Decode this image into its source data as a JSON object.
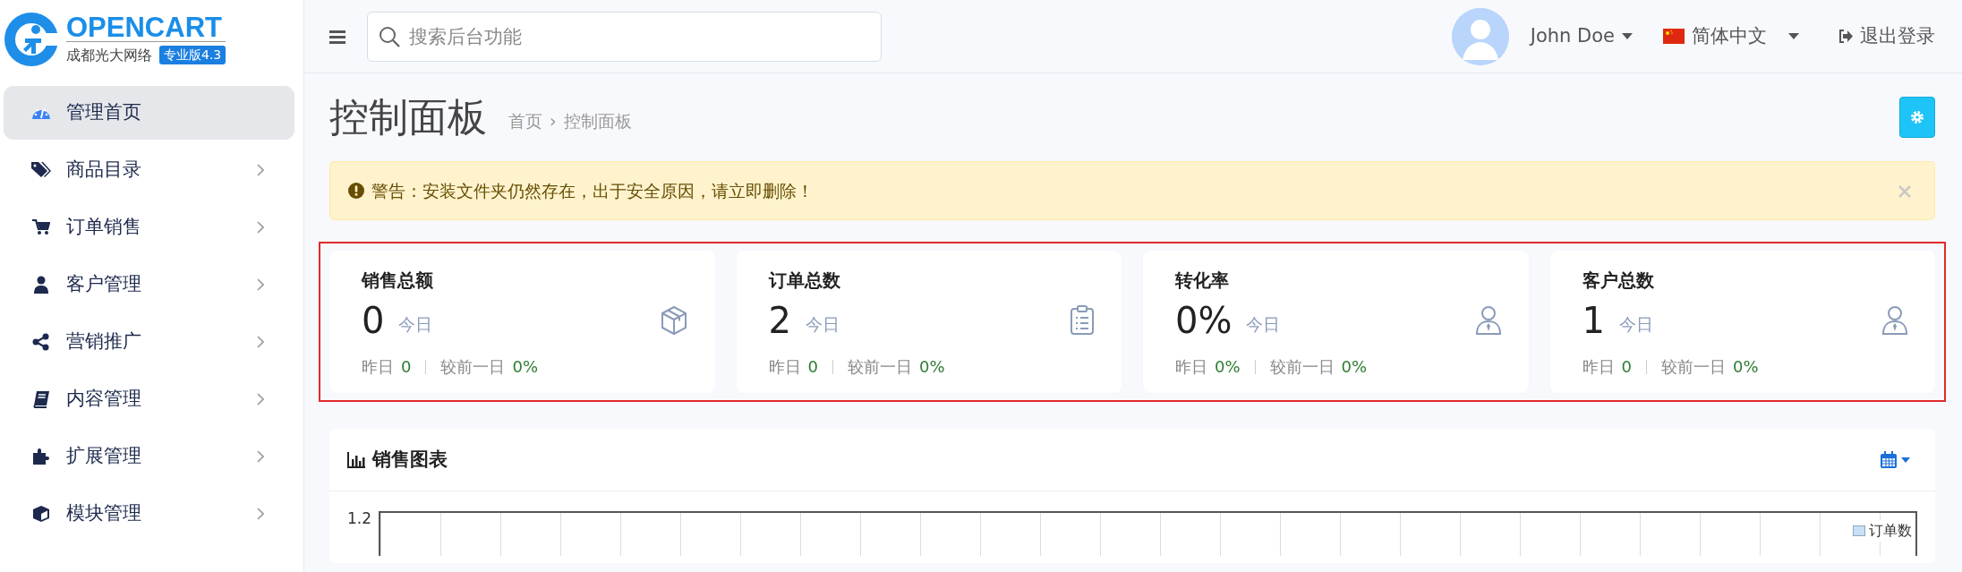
{
  "brand": {
    "name": "OPENCART",
    "subtitle": "成都光大网络",
    "edition": "专业版4.3"
  },
  "search": {
    "placeholder": "搜索后台功能"
  },
  "user": {
    "name": "John Doe"
  },
  "language": {
    "label": "简体中文"
  },
  "logout": {
    "label": "退出登录"
  },
  "sidebar": {
    "items": [
      {
        "label": "管理首页",
        "kind": "dashboard",
        "selected": true,
        "expandable": false
      },
      {
        "label": "商品目录",
        "kind": "tag",
        "selected": false,
        "expandable": true
      },
      {
        "label": "订单销售",
        "kind": "cart",
        "selected": false,
        "expandable": true
      },
      {
        "label": "客户管理",
        "kind": "user",
        "selected": false,
        "expandable": true
      },
      {
        "label": "营销推广",
        "kind": "share",
        "selected": false,
        "expandable": true
      },
      {
        "label": "内容管理",
        "kind": "book",
        "selected": false,
        "expandable": true
      },
      {
        "label": "扩展管理",
        "kind": "puzzle",
        "selected": false,
        "expandable": true
      },
      {
        "label": "模块管理",
        "kind": "cube",
        "selected": false,
        "expandable": true
      }
    ]
  },
  "page": {
    "title": "控制面板",
    "breadcrumbs": [
      "首页",
      "控制面板"
    ],
    "breadcrumb_separator": "›"
  },
  "alert": {
    "text": "警告：安装文件夹仍然存在，出于安全原因，请立即删除！"
  },
  "stats_highlighted": true,
  "stats": [
    {
      "title": "销售总额",
      "value": "0",
      "period": "今日",
      "yesterday_label": "昨日",
      "yesterday": "0",
      "compare_label": "较前一日",
      "compare": "0%",
      "kind": "box"
    },
    {
      "title": "订单总数",
      "value": "2",
      "period": "今日",
      "yesterday_label": "昨日",
      "yesterday": "0",
      "compare_label": "较前一日",
      "compare": "0%",
      "kind": "clipboard"
    },
    {
      "title": "转化率",
      "value": "0%",
      "period": "今日",
      "yesterday_label": "昨日",
      "yesterday": "0%",
      "compare_label": "较前一日",
      "compare": "0%",
      "kind": "person"
    },
    {
      "title": "客户总数",
      "value": "1",
      "period": "今日",
      "yesterday_label": "昨日",
      "yesterday": "0",
      "compare_label": "较前一日",
      "compare": "0%",
      "kind": "person"
    }
  ],
  "chart_panel": {
    "title": "销售图表",
    "y_tick": "1.2",
    "legend": "订单数"
  }
}
